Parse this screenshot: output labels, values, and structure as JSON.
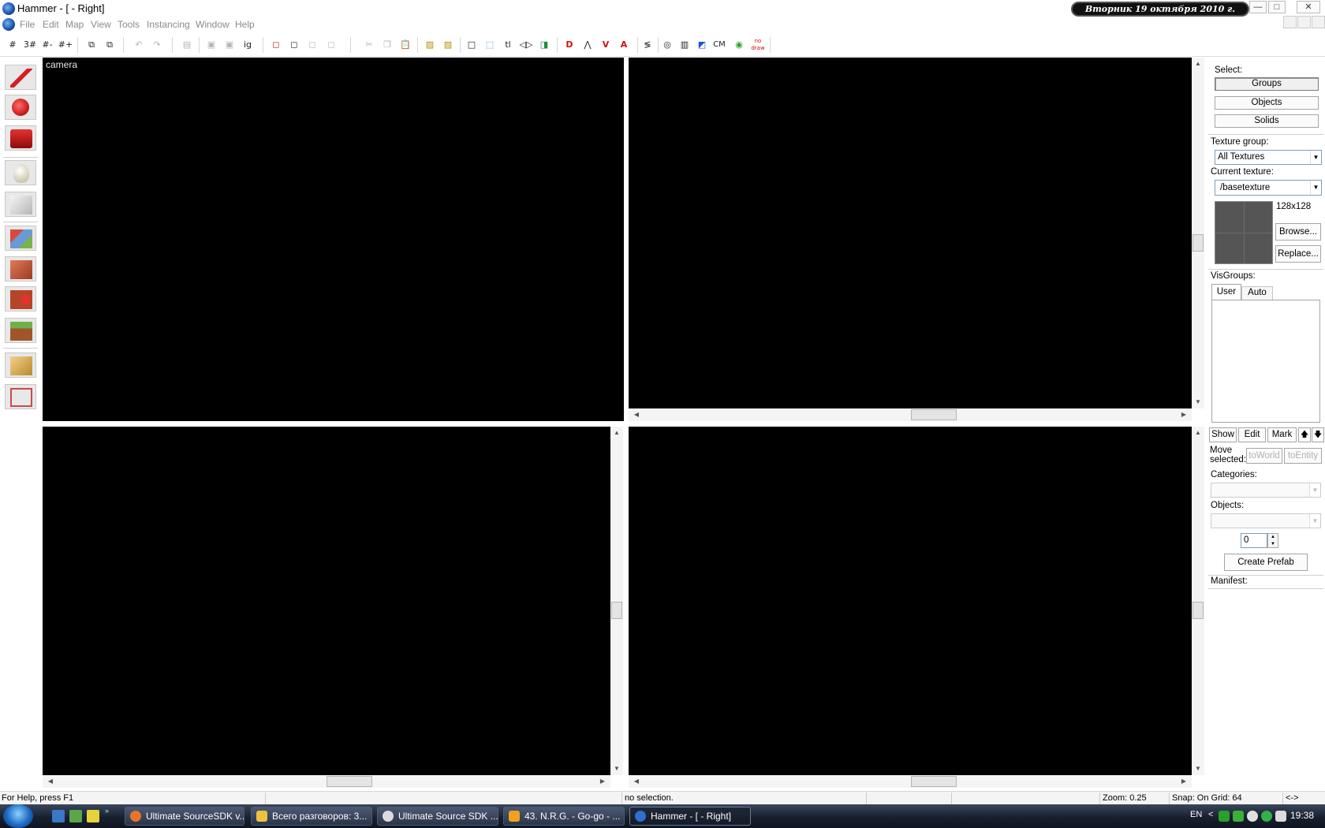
{
  "window": {
    "title": "Hammer - [ - Right]",
    "clock_banner": "Вторник 19 октября 2010 г. 19:38:18",
    "minimize": "—",
    "maximize": "□",
    "close": "✕"
  },
  "menu": {
    "items": [
      "File",
      "Edit",
      "Map",
      "View",
      "Tools",
      "Instancing",
      "Window",
      "Help"
    ]
  },
  "toolbar": {
    "buttons": [
      {
        "name": "grid-icon",
        "glyph": "#"
      },
      {
        "name": "grid-3d-icon",
        "glyph": "3#"
      },
      {
        "name": "smaller-grid-icon",
        "glyph": "#-"
      },
      {
        "name": "larger-grid-icon",
        "glyph": "#+"
      },
      {
        "name": "group-icon",
        "glyph": "⧉"
      },
      {
        "name": "ungroup-icon",
        "glyph": "⧉"
      },
      {
        "name": "undo-icon",
        "glyph": "↶"
      },
      {
        "name": "redo-icon",
        "glyph": "↷"
      },
      {
        "name": "carve-icon",
        "glyph": "▤"
      },
      {
        "name": "hollow-icon",
        "glyph": "▣"
      },
      {
        "name": "vertex-icon",
        "glyph": "▣"
      },
      {
        "name": "texture-lock-icon",
        "glyph": "ig"
      },
      {
        "name": "hide-selected-icon",
        "glyph": "◻"
      },
      {
        "name": "hide-unselected-icon",
        "glyph": "◻"
      },
      {
        "name": "show-all-icon",
        "glyph": "◻"
      },
      {
        "name": "hide-icon",
        "glyph": "◻"
      },
      {
        "name": "cut-icon",
        "glyph": "✂"
      },
      {
        "name": "copy-icon",
        "glyph": "❐"
      },
      {
        "name": "paste-icon",
        "glyph": "📋"
      },
      {
        "name": "to-world-icon",
        "glyph": "▨"
      },
      {
        "name": "to-entity-icon",
        "glyph": "▨"
      },
      {
        "name": "select-box-icon",
        "glyph": "□"
      },
      {
        "name": "select-by-handles-icon",
        "glyph": "⬚"
      },
      {
        "name": "tl-icon",
        "glyph": "tl"
      },
      {
        "name": "flip-icon",
        "glyph": "◁▷"
      },
      {
        "name": "align-icon",
        "glyph": "◨"
      },
      {
        "name": "map-info-icon",
        "glyph": "D"
      },
      {
        "name": "entity-report-icon",
        "glyph": "⋀"
      },
      {
        "name": "check-problems-icon",
        "glyph": "V"
      },
      {
        "name": "options-icon",
        "glyph": "A"
      },
      {
        "name": "run-map-icon",
        "glyph": "≶"
      },
      {
        "name": "wireframe-icon",
        "glyph": "◎"
      },
      {
        "name": "flat-icon",
        "glyph": "▥"
      },
      {
        "name": "textured-icon",
        "glyph": "◩"
      },
      {
        "name": "cubemap-icon",
        "glyph": "CM"
      },
      {
        "name": "leaf-icon",
        "glyph": "◉"
      },
      {
        "name": "nodraw-icon",
        "glyph": "no draw"
      }
    ]
  },
  "tools": [
    {
      "name": "selection-tool",
      "color": "#d62020"
    },
    {
      "name": "magnify-tool",
      "color": "#d62020"
    },
    {
      "name": "camera-tool",
      "color": "#c41414"
    },
    {
      "name": "entity-tool",
      "color": "#f2efe3"
    },
    {
      "name": "block-tool",
      "color": "#dcdcdc"
    },
    {
      "name": "texture-app-tool",
      "color": "#6a9ad6"
    },
    {
      "name": "apply-decal-tool",
      "color": "#c45b3a"
    },
    {
      "name": "overlay-tool",
      "color": "#c94a2e"
    },
    {
      "name": "clipping-tool",
      "color": "#8a6b2f"
    },
    {
      "name": "vertex-tool",
      "color": "#e0b060"
    },
    {
      "name": "path-tool",
      "color": "#c84a4a"
    }
  ],
  "viewports": {
    "top_left_label": "camera"
  },
  "panel": {
    "select_label": "Select:",
    "groups": "Groups",
    "objects": "Objects",
    "solids": "Solids",
    "texture_group_label": "Texture group:",
    "texture_group_value": "All Textures",
    "current_texture_label": "Current texture:",
    "current_texture_value": "/basetexture",
    "texture_size": "128x128",
    "browse": "Browse...",
    "replace": "Replace...",
    "visgroups_label": "VisGroups:",
    "tab_user": "User",
    "tab_auto": "Auto",
    "show": "Show",
    "edit": "Edit",
    "mark": "Mark",
    "up": "🡅",
    "down": "🡇",
    "move_selected": "Move selected:",
    "to_world": "toWorld",
    "to_entity": "toEntity",
    "categories_label": "Categories:",
    "objects_label": "Objects:",
    "count_value": "0",
    "create_prefab": "Create Prefab",
    "manifest_label": "Manifest:"
  },
  "status": {
    "help": "For Help, press F1",
    "selection": "no selection.",
    "zoom": "Zoom: 0.25",
    "snap": "Snap: On Grid: 64",
    "arrows": "<->"
  },
  "taskbar": {
    "tasks": [
      {
        "label": "Ultimate SourceSDK v...",
        "color": "#e8742a"
      },
      {
        "label": "Всего разговоров: 3...",
        "color": "#f0c040"
      },
      {
        "label": "Ultimate Source SDK ...",
        "color": "#dcdcdc"
      },
      {
        "label": "43. N.R.G. - Go-go - ...",
        "color": "#f2a020"
      },
      {
        "label": "Hammer - [ - Right]",
        "color": "#2f6fd0"
      }
    ],
    "lang": "EN",
    "time": "19:38"
  }
}
